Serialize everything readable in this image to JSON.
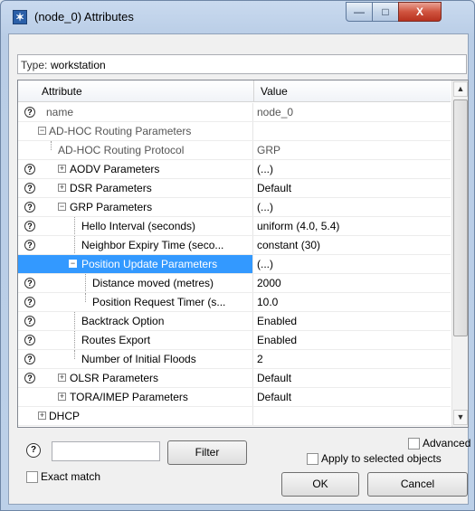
{
  "window": {
    "title": "(node_0) Attributes",
    "minimize": "—",
    "maximize": "□",
    "close": "X"
  },
  "type_field": {
    "label": "Type:",
    "value": "workstation"
  },
  "grid": {
    "headers": {
      "attribute": "Attribute",
      "value": "Value"
    },
    "rows": [
      {
        "attribute": "name",
        "value": "node_0"
      },
      {
        "attribute": "AD-HOC Routing Parameters",
        "value": ""
      },
      {
        "attribute": "AD-HOC Routing Protocol",
        "value": "GRP"
      },
      {
        "attribute": "AODV Parameters",
        "value": "(...)"
      },
      {
        "attribute": "DSR Parameters",
        "value": "Default"
      },
      {
        "attribute": "GRP Parameters",
        "value": "(...)"
      },
      {
        "attribute": "Hello Interval (seconds)",
        "value": "uniform (4.0, 5.4)"
      },
      {
        "attribute": "Neighbor Expiry Time (seco...",
        "value": "constant (30)"
      },
      {
        "attribute": "Position Update Parameters",
        "value": "(...)"
      },
      {
        "attribute": "Distance moved (metres)",
        "value": "2000"
      },
      {
        "attribute": "Position Request Timer (s...",
        "value": "10.0"
      },
      {
        "attribute": "Backtrack Option",
        "value": "Enabled"
      },
      {
        "attribute": "Routes Export",
        "value": "Enabled"
      },
      {
        "attribute": "Number of Initial Floods",
        "value": "2"
      },
      {
        "attribute": "OLSR Parameters",
        "value": "Default"
      },
      {
        "attribute": "TORA/IMEP Parameters",
        "value": "Default"
      },
      {
        "attribute": "DHCP",
        "value": ""
      }
    ]
  },
  "help_glyph": "?",
  "expand_plus": "+",
  "collapse_minus": "−",
  "filter": {
    "button": "Filter",
    "value": ""
  },
  "checks": {
    "exact_match": "Exact match",
    "advanced": "Advanced",
    "apply_selected": "Apply to selected objects"
  },
  "buttons": {
    "ok": "OK",
    "cancel": "Cancel"
  },
  "scroll": {
    "up": "▲",
    "down": "▼"
  }
}
